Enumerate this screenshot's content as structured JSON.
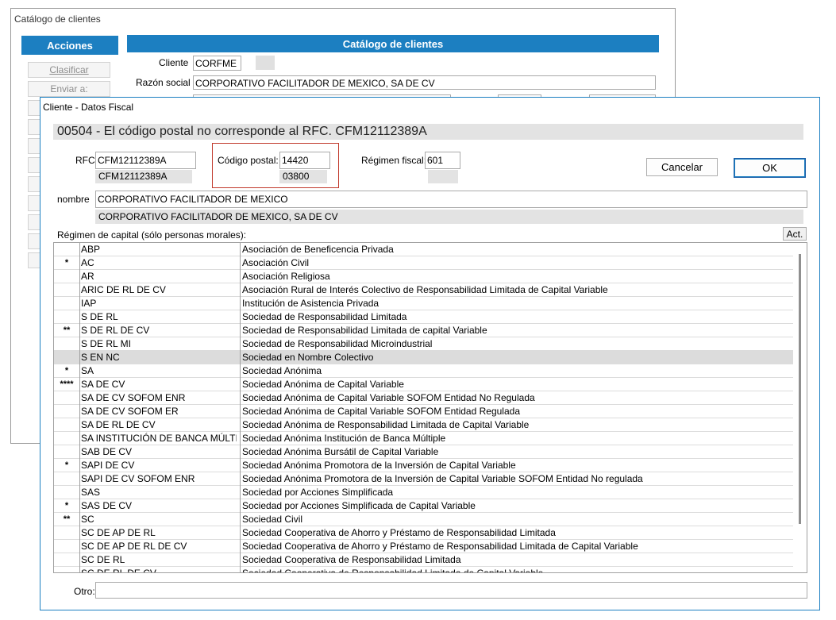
{
  "back_window": {
    "title": "Catálogo de clientes",
    "actions_header": "Acciones",
    "catalog_header": "Catálogo de clientes",
    "buttons": [
      "Clasificar",
      "Enviar a:"
    ],
    "cliente_label": "Cliente",
    "cliente_value": "CORFME",
    "razon_label": "Razón social",
    "razon_value": "CORPORATIVO FACILITADOR DE MEXICO, SA DE CV"
  },
  "dialog": {
    "title": "Cliente - Datos Fiscal",
    "error_message": "00504 - El código postal no corresponde al RFC. CFM12112389A",
    "rfc_label": "RFC:",
    "rfc_value": "CFM12112389A",
    "rfc_current": "CFM12112389A",
    "cp_label": "Código postal:",
    "cp_value": "14420",
    "cp_current": "03800",
    "regimen_label": "Régimen fiscal:",
    "regimen_value": "601",
    "regimen_current": "",
    "cancel_label": "Cancelar",
    "ok_label": "OK",
    "nombre_label": "nombre",
    "nombre_value": "CORPORATIVO FACILITADOR DE MEXICO",
    "nombre_current": "CORPORATIVO FACILITADOR DE MEXICO, SA DE CV",
    "capital_label": "Régimen de capital (sólo personas morales):",
    "act_label": "Act.",
    "otro_label": "Otro:",
    "otro_value": ""
  },
  "capital_rows": [
    {
      "mark": "",
      "code": "ABP",
      "desc": "Asociación de Beneficencia Privada"
    },
    {
      "mark": "*",
      "code": "AC",
      "desc": "Asociación Civil"
    },
    {
      "mark": "",
      "code": "AR",
      "desc": "Asociación Religiosa"
    },
    {
      "mark": "",
      "code": "ARIC DE RL DE CV",
      "desc": "Asociación Rural de Interés Colectivo de Responsabilidad Limitada de Capital Variable"
    },
    {
      "mark": "",
      "code": "IAP",
      "desc": "Institución de Asistencia Privada"
    },
    {
      "mark": "",
      "code": "S DE RL",
      "desc": "Sociedad de Responsabilidad Limitada"
    },
    {
      "mark": "**",
      "code": "S DE RL DE CV",
      "desc": "Sociedad de Responsabilidad Limitada de capital Variable"
    },
    {
      "mark": "",
      "code": "S DE RL MI",
      "desc": "Sociedad de Responsabilidad Microindustrial"
    },
    {
      "mark": "",
      "code": "S EN NC",
      "desc": "Sociedad en Nombre Colectivo",
      "selected": true
    },
    {
      "mark": "*",
      "code": "SA",
      "desc": "Sociedad Anónima"
    },
    {
      "mark": "****",
      "code": "SA DE CV",
      "desc": "Sociedad Anónima de Capital Variable"
    },
    {
      "mark": "",
      "code": "SA DE CV SOFOM ENR",
      "desc": "Sociedad Anónima de Capital Variable SOFOM Entidad No Regulada"
    },
    {
      "mark": "",
      "code": "SA DE CV SOFOM ER",
      "desc": "Sociedad Anónima de Capital Variable SOFOM Entidad Regulada"
    },
    {
      "mark": "",
      "code": "SA DE RL DE CV",
      "desc": "Sociedad Anónima de Responsabilidad Limitada de Capital Variable"
    },
    {
      "mark": "",
      "code": "SA INSTITUCIÓN DE BANCA MÚLTIPLE",
      "desc": "Sociedad Anónima Institución de Banca Múltiple"
    },
    {
      "mark": "",
      "code": "SAB DE CV",
      "desc": "Sociedad Anónima Bursátil de Capital Variable"
    },
    {
      "mark": "*",
      "code": "SAPI DE CV",
      "desc": "Sociedad Anónima Promotora de la Inversión de Capital Variable"
    },
    {
      "mark": "",
      "code": "SAPI DE CV SOFOM ENR",
      "desc": "Sociedad Anónima Promotora de la Inversión de Capital Variable SOFOM Entidad No regulada"
    },
    {
      "mark": "",
      "code": "SAS",
      "desc": "Sociedad por Acciones Simplificada"
    },
    {
      "mark": "*",
      "code": "SAS DE CV",
      "desc": "Sociedad por Acciones Simplificada de Capital Variable"
    },
    {
      "mark": "**",
      "code": "SC",
      "desc": "Sociedad Civil"
    },
    {
      "mark": "",
      "code": "SC DE AP DE RL",
      "desc": "Sociedad Cooperativa de Ahorro y Préstamo de Responsabilidad Limitada"
    },
    {
      "mark": "",
      "code": "SC DE AP DE RL DE CV",
      "desc": "Sociedad Cooperativa de Ahorro y Préstamo de Responsabilidad Limitada de Capital Variable"
    },
    {
      "mark": "",
      "code": "SC DE RL",
      "desc": "Sociedad Cooperativa de Responsabilidad Limitada"
    },
    {
      "mark": "",
      "code": "SC DE RL DE CV",
      "desc": "Sociedad Cooperativa de Responsabilidad Limitada de Capital Variable"
    }
  ]
}
